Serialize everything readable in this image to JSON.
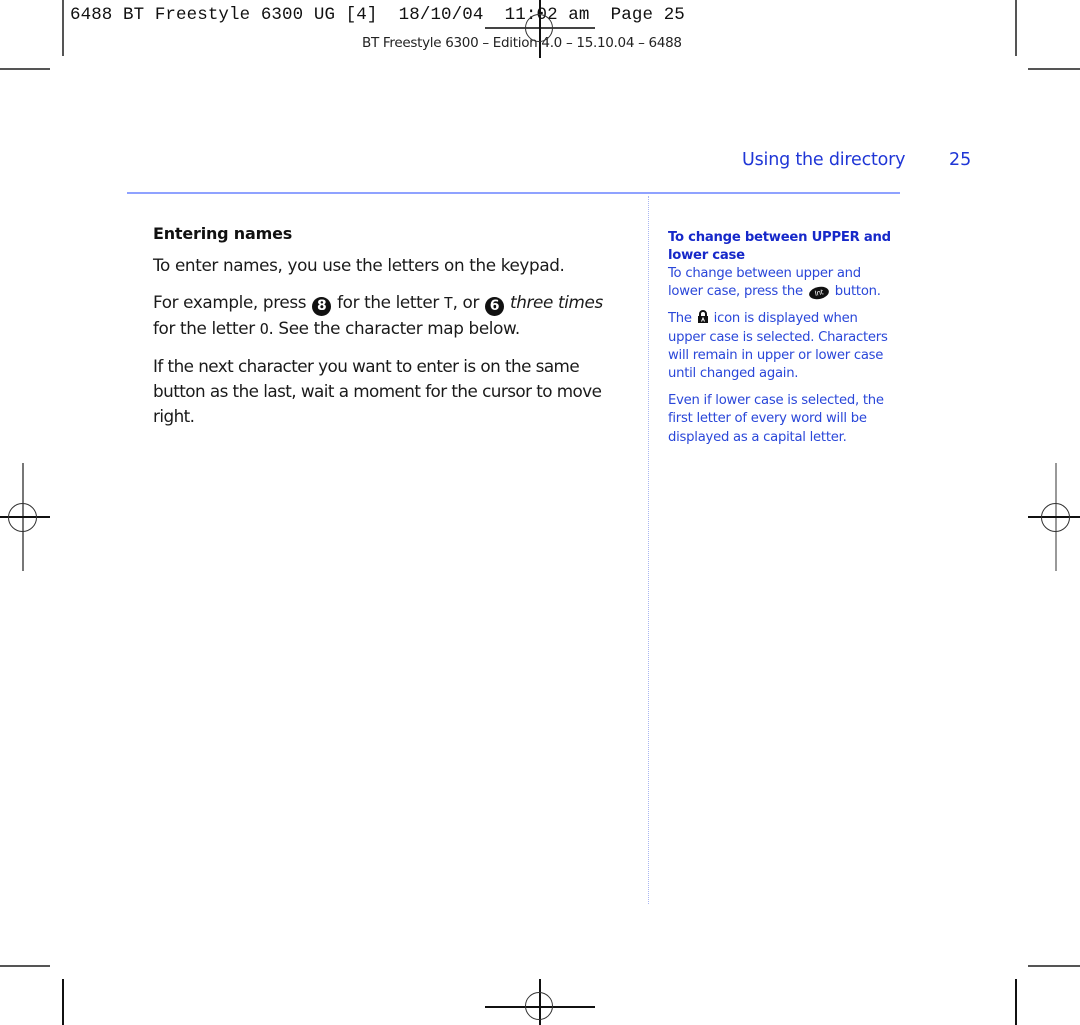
{
  "print_slug": {
    "text": "6488 BT Freestyle 6300 UG [4]  18/10/04  11:02 am  Page 25",
    "edition_line": "BT Freestyle 6300 – Edition 4.0 – 15.10.04 – 6488"
  },
  "header": {
    "section_title": "Using the directory",
    "page_number": "25"
  },
  "main": {
    "heading": "Entering names",
    "para1": "To enter names, you use the letters on the keypad.",
    "para2": {
      "prefix": "For example, press ",
      "key1": "8",
      "mid1": " for the letter ",
      "letter1": "T",
      "mid2": ", or ",
      "key2": "6",
      "emph": " three times",
      "mid3": "for the letter ",
      "letter2": "O",
      "suffix": ". See the character map below."
    },
    "para3": "If the next character you want to enter is on the same button as the last, wait a moment for the cursor to move right."
  },
  "sidebar": {
    "heading": "To change between UPPER and lower case",
    "para1": {
      "prefix": "To change between upper and lower case, press the ",
      "button_label": "Int",
      "suffix": " button."
    },
    "para2": {
      "prefix": "The ",
      "suffix": " icon is displayed when upper case is selected. Characters will remain in upper or lower case until changed again."
    },
    "para3": "Even if lower case is selected, the first letter of every word will be displayed as a capital letter."
  },
  "colors": {
    "accent_blue": "#1f36d6",
    "rule_blue": "#8fa2ff",
    "sidebar_text": "#2a47d9"
  }
}
